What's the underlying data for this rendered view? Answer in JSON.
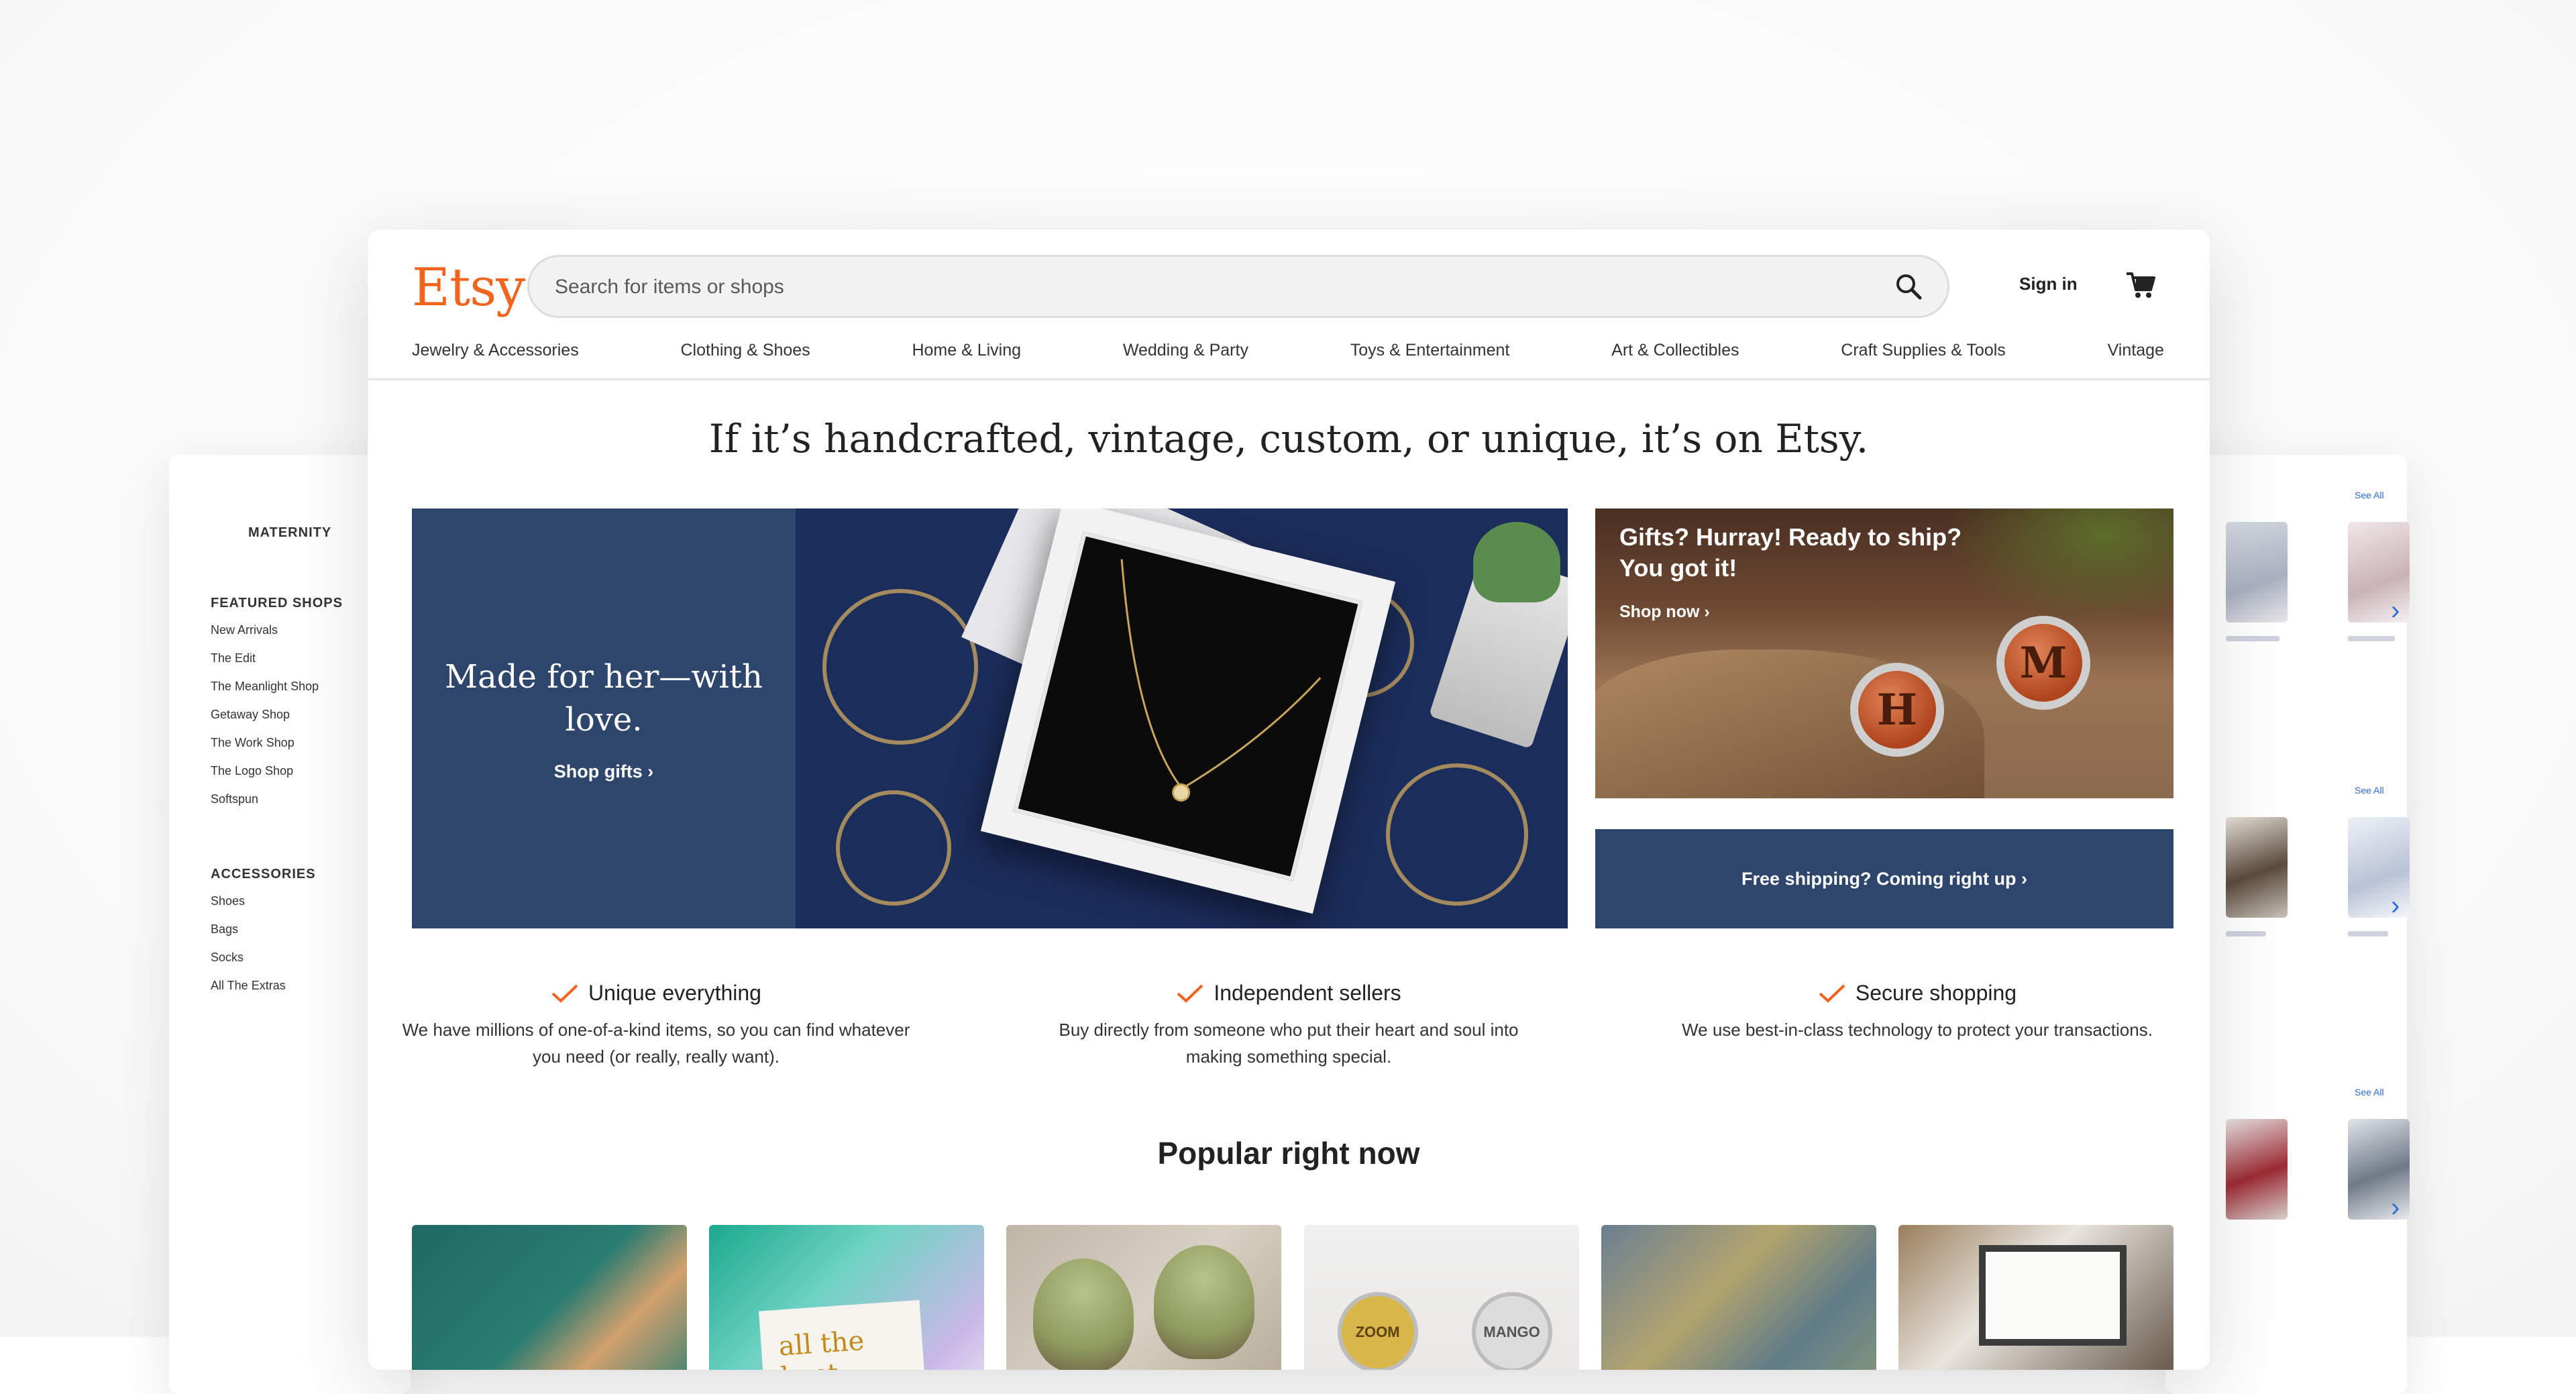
{
  "left_panel": {
    "title": "MATERNITY",
    "featured_heading": "FEATURED SHOPS",
    "featured_items": [
      "New Arrivals",
      "The Edit",
      "The Meanlight Shop",
      "Getaway Shop",
      "The Work Shop",
      "The Logo Shop",
      "Softspun"
    ],
    "accessories_heading": "ACCESSORIES",
    "accessories_items": [
      "Shoes",
      "Bags",
      "Socks",
      "All The Extras"
    ]
  },
  "right_panel": {
    "see_all": "See All"
  },
  "header": {
    "logo": "Etsy",
    "search_placeholder": "Search for items or shops",
    "sign_in": "Sign in",
    "search_icon": "search-icon",
    "cart_icon": "cart-icon"
  },
  "categories": [
    "Jewelry & Accessories",
    "Clothing & Shoes",
    "Home & Living",
    "Wedding & Party",
    "Toys & Entertainment",
    "Art & Collectibles",
    "Craft Supplies & Tools",
    "Vintage"
  ],
  "tagline": "If it’s handcrafted, vintage, custom, or unique, it’s on Etsy.",
  "hero": {
    "title": "Made for her—with love.",
    "link": "Shop gifts  ›"
  },
  "promo_top": {
    "title": "Gifts? Hurray! Ready to ship? You got it!",
    "link": "Shop now  ›",
    "letters": [
      "H",
      "M"
    ]
  },
  "promo_bottom": {
    "label": "Free shipping? Coming right up  ›"
  },
  "value_props": [
    {
      "title": "Unique everything",
      "body": "We have millions of one-of-a-kind items, so you can find whatever you need (or really, really want)."
    },
    {
      "title": "Independent sellers",
      "body": "Buy directly from someone who put their heart and soul into making something special."
    },
    {
      "title": "Secure shopping",
      "body": "We use best-in-class technology to protect your transactions."
    }
  ],
  "popular_heading": "Popular right now",
  "popular_tiles": {
    "card_text": "all the best",
    "tag_texts": [
      "ZOOM",
      "MANGO"
    ]
  },
  "colors": {
    "brand_orange": "#f1641e",
    "navy": "#2f466c",
    "link_blue": "#2d6bd6"
  }
}
